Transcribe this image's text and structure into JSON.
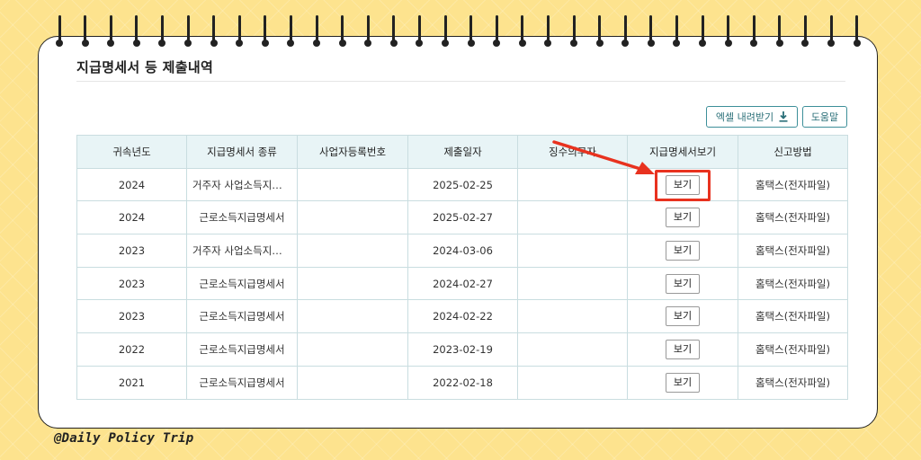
{
  "page": {
    "title": "지급명세서 등 제출내역",
    "watermark": "@Daily Policy Trip"
  },
  "toolbar": {
    "excel_label": "엑셀 내려받기",
    "help_label": "도움말"
  },
  "table": {
    "headers": [
      "귀속년도",
      "지급명세서 종류",
      "사업자등록번호",
      "제출일자",
      "징수의무자",
      "지급명세서보기",
      "신고방법"
    ],
    "rows": [
      {
        "year": "2024",
        "type": "거주자 사업소득지…",
        "bizno": "",
        "date": "2025-02-25",
        "payer": "",
        "view": "보기",
        "method": "홈택스(전자파일)"
      },
      {
        "year": "2024",
        "type": "근로소득지급명세서",
        "bizno": "",
        "date": "2025-02-27",
        "payer": "",
        "view": "보기",
        "method": "홈택스(전자파일)"
      },
      {
        "year": "2023",
        "type": "거주자 사업소득지…",
        "bizno": "",
        "date": "2024-03-06",
        "payer": "",
        "view": "보기",
        "method": "홈택스(전자파일)"
      },
      {
        "year": "2023",
        "type": "근로소득지급명세서",
        "bizno": "",
        "date": "2024-02-27",
        "payer": "",
        "view": "보기",
        "method": "홈택스(전자파일)"
      },
      {
        "year": "2023",
        "type": "근로소득지급명세서",
        "bizno": "",
        "date": "2024-02-22",
        "payer": "",
        "view": "보기",
        "method": "홈택스(전자파일)"
      },
      {
        "year": "2022",
        "type": "근로소득지급명세서",
        "bizno": "",
        "date": "2023-02-19",
        "payer": "",
        "view": "보기",
        "method": "홈택스(전자파일)"
      },
      {
        "year": "2021",
        "type": "근로소득지급명세서",
        "bizno": "",
        "date": "2022-02-18",
        "payer": "",
        "view": "보기",
        "method": "홈택스(전자파일)"
      }
    ]
  },
  "colors": {
    "background": "#fde38e",
    "header_bg": "#e8f4f6",
    "accent": "#3d8f99",
    "highlight": "#e8321f"
  },
  "icons": {
    "download": "download-icon",
    "arrow": "red-arrow-annotation"
  }
}
